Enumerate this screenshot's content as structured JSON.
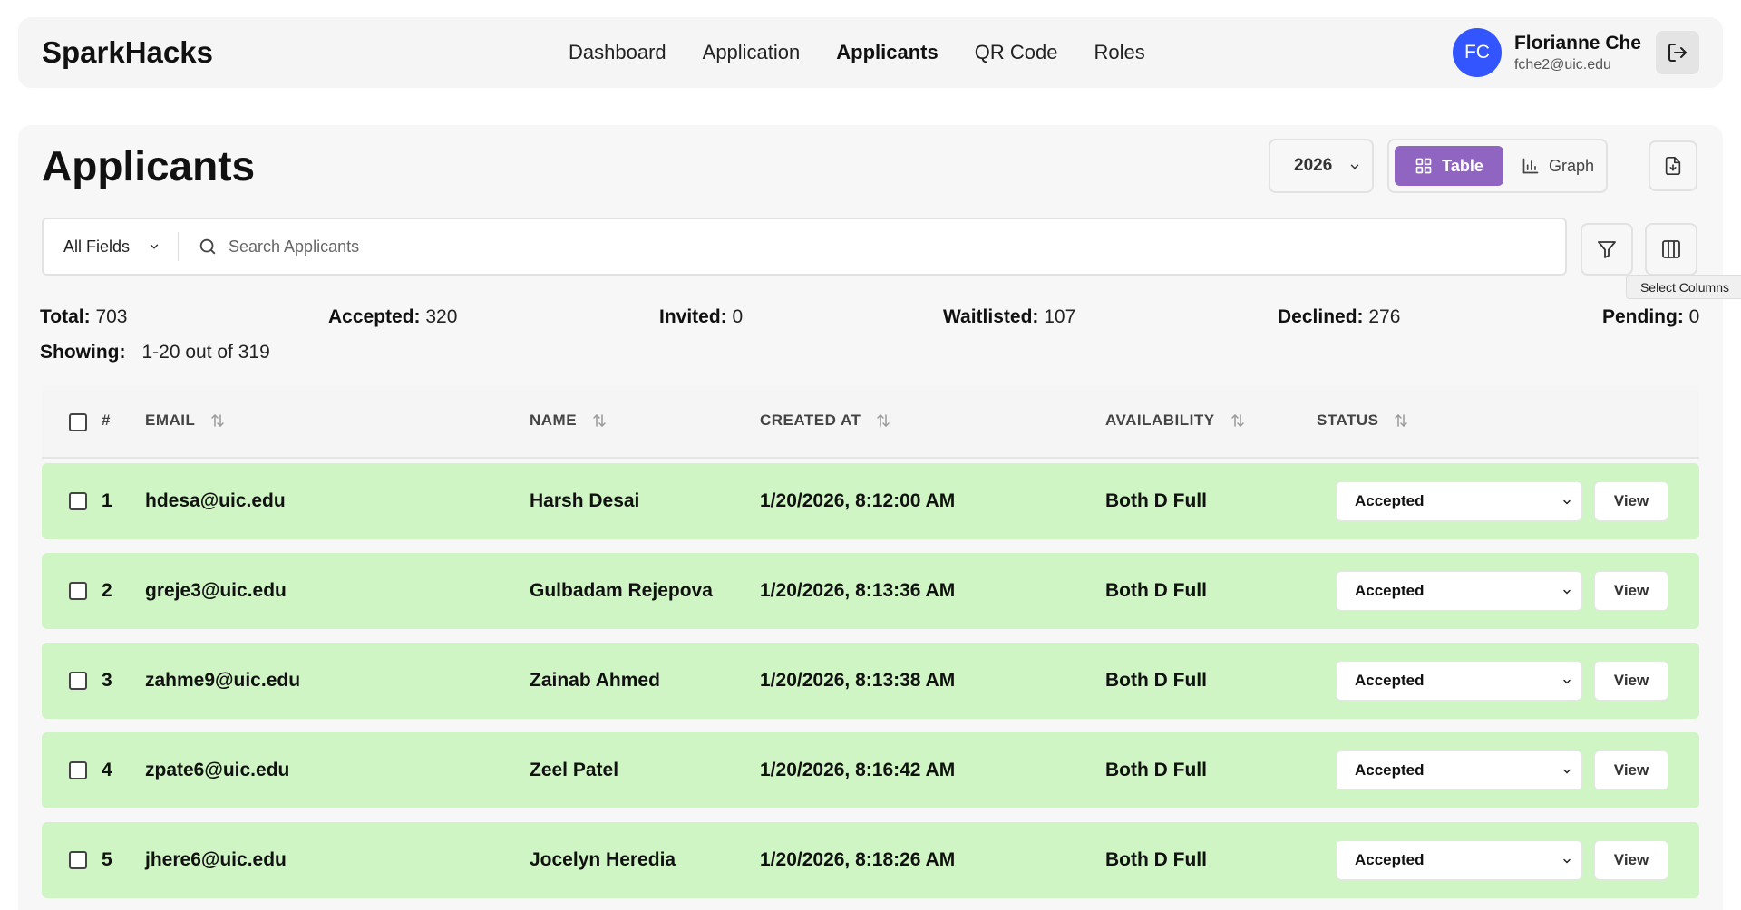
{
  "header": {
    "brand": "SparkHacks",
    "nav": [
      {
        "label": "Dashboard",
        "active": false
      },
      {
        "label": "Application",
        "active": false
      },
      {
        "label": "Applicants",
        "active": true
      },
      {
        "label": "QR Code",
        "active": false
      },
      {
        "label": "Roles",
        "active": false
      }
    ],
    "user": {
      "initials": "FC",
      "name": "Florianne Che",
      "email": "fche2@uic.edu",
      "avatar_color": "#3355ff"
    }
  },
  "page": {
    "title": "Applicants",
    "year": "2026",
    "view_toggle": {
      "table_label": "Table",
      "graph_label": "Graph",
      "selected": "Table",
      "accent": "#9065c2"
    },
    "search": {
      "field": "All Fields",
      "placeholder": "Search Applicants",
      "value": ""
    },
    "tooltip": "Select Columns"
  },
  "stats": {
    "total_label": "Total:",
    "total": "703",
    "accepted_label": "Accepted:",
    "accepted": "320",
    "invited_label": "Invited:",
    "invited": "0",
    "waitlisted_label": "Waitlisted:",
    "waitlisted": "107",
    "declined_label": "Declined:",
    "declined": "276",
    "pending_label": "Pending:",
    "pending": "0",
    "showing_label": "Showing:",
    "showing": "1-20 out of 319"
  },
  "table": {
    "columns": {
      "num": "#",
      "email": "EMAIL",
      "name": "NAME",
      "created": "CREATED AT",
      "availability": "AVAILABILITY",
      "status": "STATUS"
    },
    "row_color": "#cff5c4",
    "view_label": "View",
    "rows": [
      {
        "num": "1",
        "email": "hdesa@uic.edu",
        "name": "Harsh Desai",
        "created": "1/20/2026, 8:12:00 AM",
        "availability": "Both D Full",
        "status": "Accepted"
      },
      {
        "num": "2",
        "email": "greje3@uic.edu",
        "name": "Gulbadam Rejepova",
        "created": "1/20/2026, 8:13:36 AM",
        "availability": "Both D Full",
        "status": "Accepted"
      },
      {
        "num": "3",
        "email": "zahme9@uic.edu",
        "name": "Zainab Ahmed",
        "created": "1/20/2026, 8:13:38 AM",
        "availability": "Both D Full",
        "status": "Accepted"
      },
      {
        "num": "4",
        "email": "zpate6@uic.edu",
        "name": "Zeel Patel",
        "created": "1/20/2026, 8:16:42 AM",
        "availability": "Both D Full",
        "status": "Accepted"
      },
      {
        "num": "5",
        "email": "jhere6@uic.edu",
        "name": "Jocelyn Heredia",
        "created": "1/20/2026, 8:18:26 AM",
        "availability": "Both D Full",
        "status": "Accepted"
      }
    ]
  }
}
